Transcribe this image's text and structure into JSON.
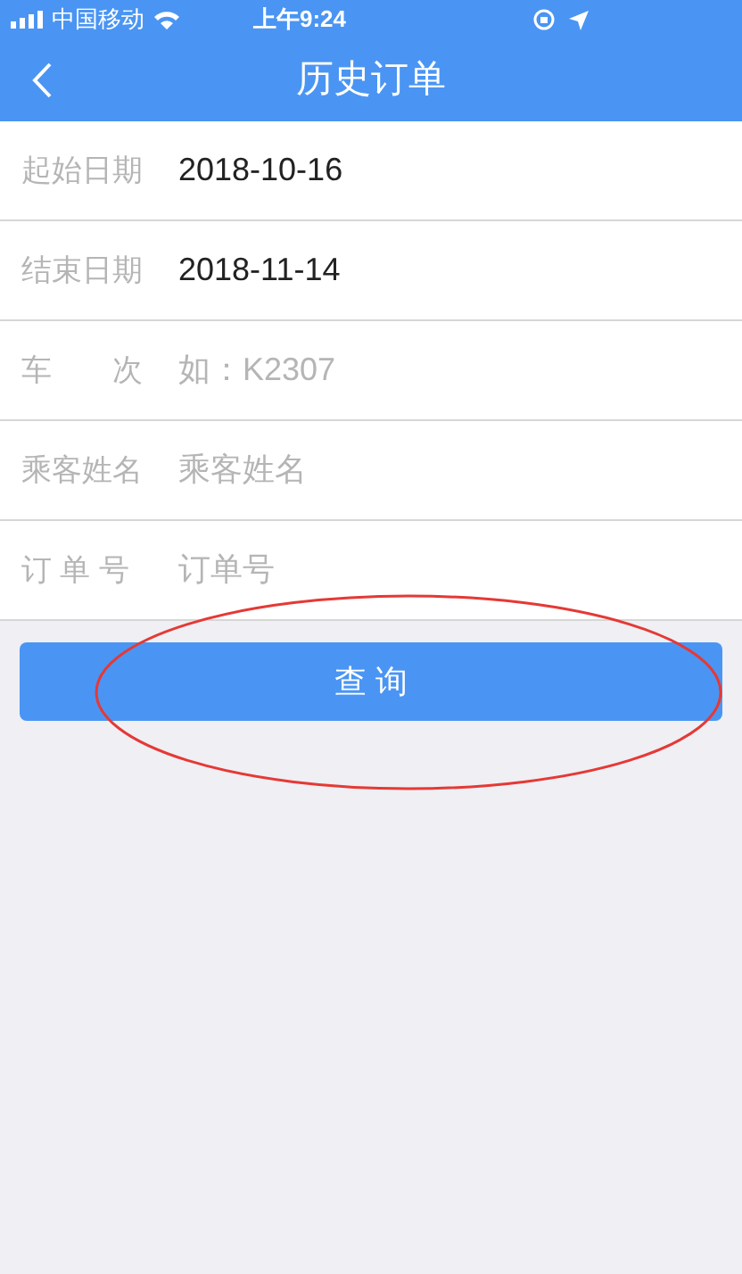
{
  "status_bar": {
    "carrier": "中国移动",
    "time": "上午9:24"
  },
  "nav": {
    "title": "历史订单"
  },
  "fields": [
    {
      "label": "起始日期",
      "value": "2018-10-16"
    },
    {
      "label": "结束日期",
      "value": "2018-11-14"
    },
    {
      "label": "车　　次",
      "placeholder": "如：K2307"
    },
    {
      "label": "乘客姓名",
      "placeholder": "乘客姓名"
    },
    {
      "label": "订 单 号",
      "placeholder": "订单号"
    }
  ],
  "submit": {
    "label": "查 询"
  }
}
